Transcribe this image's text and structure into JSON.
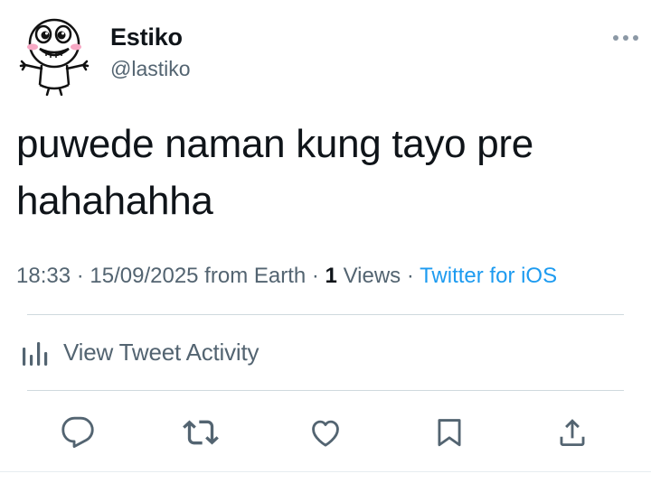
{
  "author": {
    "display_name": "Estiko",
    "handle": "@lastiko",
    "avatar_icon": "cartoon-face-avatar"
  },
  "tweet": {
    "text": "puwede naman kung tayo pre\nhahahahha"
  },
  "meta": {
    "time": "18:33",
    "sep1": " · ",
    "date": "15/09/2025",
    "location": " from Earth",
    "sep2": " · ",
    "views_count": "1",
    "views_label": " Views",
    "sep3": " · ",
    "source": "Twitter for iOS"
  },
  "activity": {
    "label": "View Tweet Activity",
    "icon": "bar-chart-icon"
  },
  "actions": [
    "reply-icon",
    "retweet-icon",
    "like-icon",
    "bookmark-icon",
    "share-icon"
  ],
  "colors": {
    "text": "#0f1419",
    "secondary": "#536471",
    "link": "#1d9bf0",
    "divider": "#cfd9de"
  }
}
